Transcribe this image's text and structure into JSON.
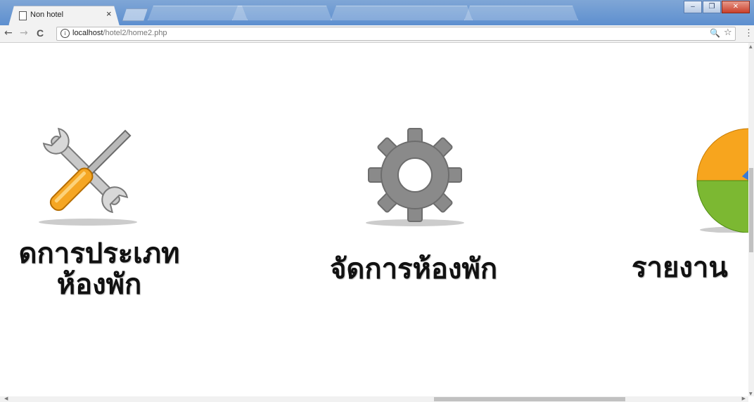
{
  "browser": {
    "tab_title": "Non hotel",
    "tab_close": "×",
    "url_host": "localhost",
    "url_path": "/hotel2/home2.php",
    "info_glyph": "i",
    "back_glyph": "←",
    "forward_glyph": "→",
    "reload_glyph": "C",
    "zoom_glyph": "🔍",
    "star_glyph": "☆",
    "menu_glyph": "⋮",
    "minimize_glyph": "–",
    "restore_glyph": "❐",
    "close_glyph": "✕"
  },
  "menu": {
    "items": [
      {
        "line1": "ดการประเภท",
        "line2": "ห้องพัก",
        "icon": "tools-icon"
      },
      {
        "line1": "จัดการห้องพัก",
        "icon": "gear-icon"
      },
      {
        "line1": "รายงาน",
        "icon": "pie-chart-icon"
      }
    ]
  },
  "colors": {
    "titlebar": "#5d8fcf",
    "label_text": "#111111",
    "handle_orange": "#f5a623",
    "gear_gray": "#8a8a8a",
    "pie_green": "#7cb832",
    "pie_orange": "#f7a51e"
  }
}
